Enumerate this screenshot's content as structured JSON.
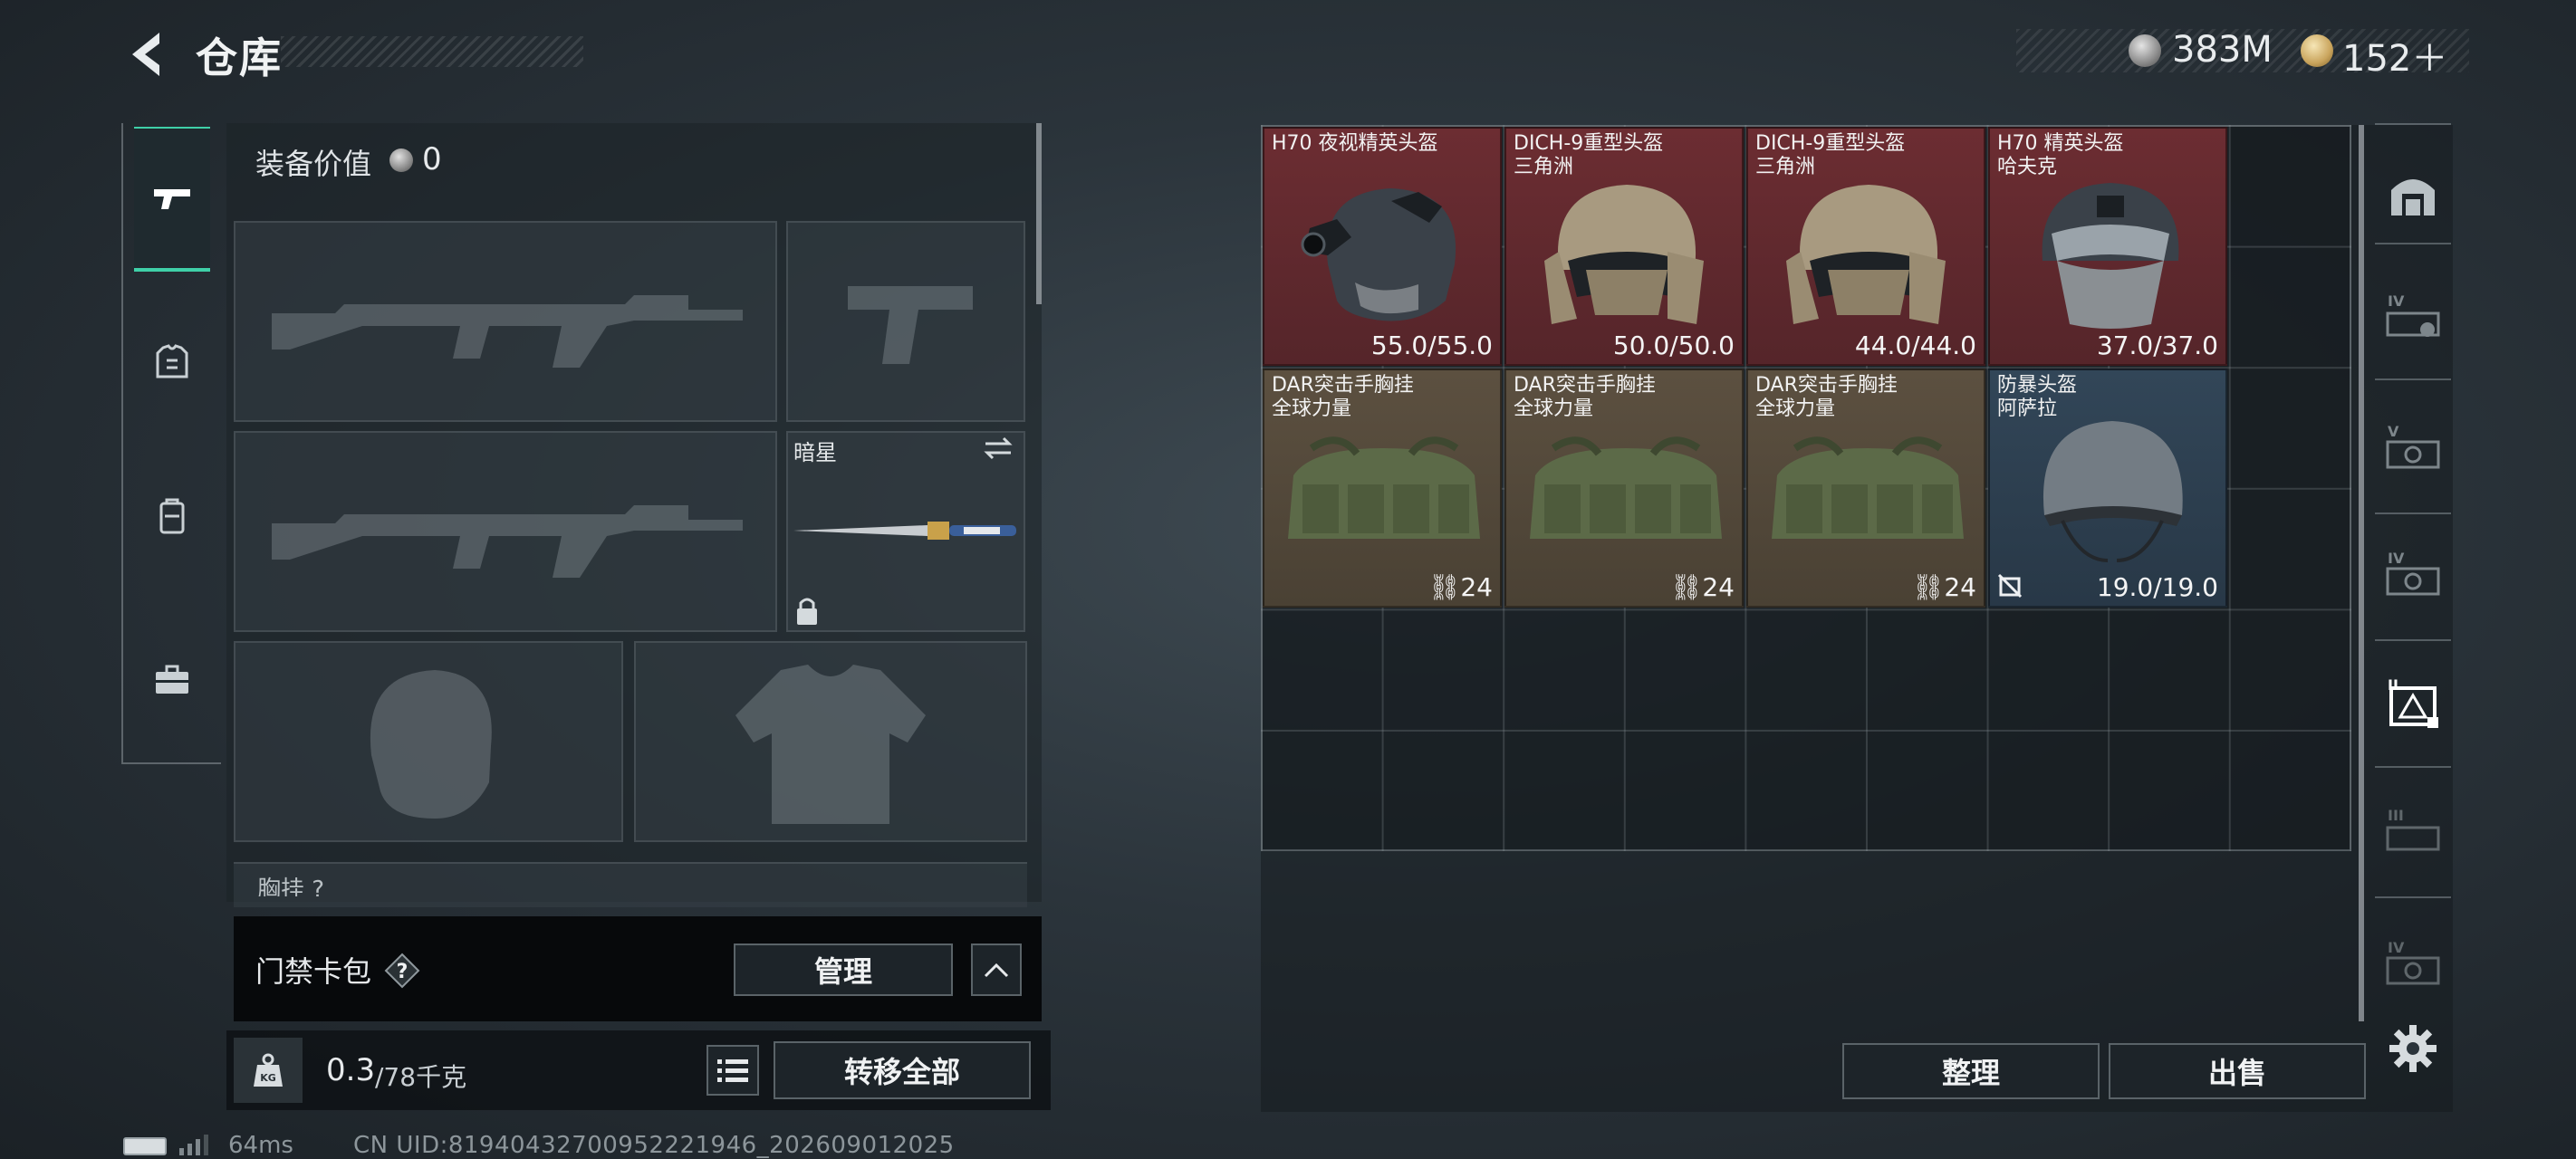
{
  "header": {
    "title": "仓库"
  },
  "currency": {
    "silver": "383M",
    "gold": "152＋"
  },
  "categories": [
    {
      "id": "weapons",
      "icon": "pistol-icon",
      "active": true
    },
    {
      "id": "armor",
      "icon": "armor-icon",
      "active": false
    },
    {
      "id": "backpack",
      "icon": "backpack-icon",
      "active": false
    },
    {
      "id": "case",
      "icon": "briefcase-icon",
      "active": false
    }
  ],
  "loadout": {
    "equipment_value_label": "装备价值",
    "equipment_value": "0",
    "melee_name": "暗星",
    "chest_rig_label": "胸挂 ?"
  },
  "keycard": {
    "label": "门禁卡包",
    "manage": "管理"
  },
  "weight": {
    "current": "0.3",
    "max": "/78千克",
    "transfer_all": "转移全部"
  },
  "status": {
    "ping": "64ms",
    "uid": "CN UID:8194043270095222​1946_202609012025"
  },
  "stash": {
    "items": [
      {
        "name1": "H70 夜视精英头盔",
        "name2": "",
        "value": "55.0/55.0",
        "rarity": "red"
      },
      {
        "name1": "DICH-9重型头盔",
        "name2": "三角洲",
        "value": "50.0/50.0",
        "rarity": "red"
      },
      {
        "name1": "DICH-9重型头盔",
        "name2": "三角洲",
        "value": "44.0/44.0",
        "rarity": "red"
      },
      {
        "name1": "H70 精英头盔",
        "name2": "哈夫克",
        "value": "37.0/37.0",
        "rarity": "red"
      },
      {
        "name1": "DAR突击手胸挂",
        "name2": "全球力量",
        "value": "24",
        "rarity": "gold"
      },
      {
        "name1": "DAR突击手胸挂",
        "name2": "全球力量",
        "value": "24",
        "rarity": "gold"
      },
      {
        "name1": "DAR突击手胸挂",
        "name2": "全球力量",
        "value": "24",
        "rarity": "gold"
      },
      {
        "name1": "防暴头盔",
        "name2": "阿萨拉",
        "value": "19.0/19.0",
        "rarity": "blue"
      }
    ],
    "sort_label": "整理",
    "sell_label": "出售"
  },
  "colors": {
    "accent": "#3fd0a8",
    "rarity_red": "#6c2d32",
    "rarity_gold": "#5c5040",
    "rarity_blue": "#324658"
  }
}
